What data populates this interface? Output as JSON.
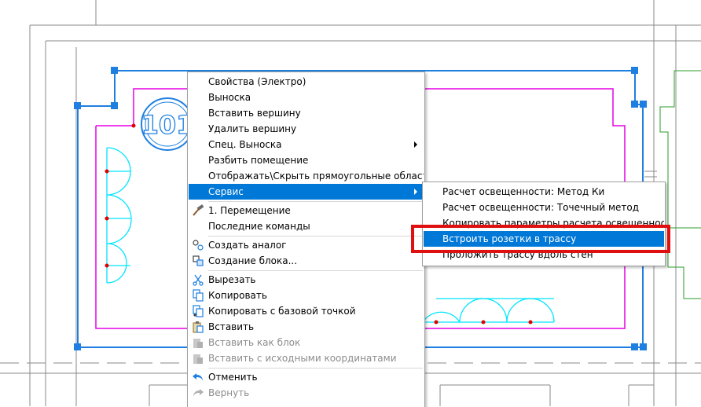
{
  "room_number": "101",
  "context_menu": {
    "items": [
      {
        "label": "Свойства (Электро)"
      },
      {
        "label": "Выноска"
      },
      {
        "label": "Вставить вершину"
      },
      {
        "label": "Удалить вершину"
      },
      {
        "label": "Спец. Выноска",
        "submenu": true
      },
      {
        "label": "Разбить помещение"
      },
      {
        "label": "Отображать\\Скрыть прямоугольные области"
      },
      {
        "label": "Сервис",
        "submenu": true,
        "highlighted": true
      },
      {
        "label": "1. Перемещение",
        "icon": "hammer-icon"
      },
      {
        "label": "Последние команды",
        "submenu": true
      },
      {
        "label": "Создать аналог",
        "icon": "create-analog-icon"
      },
      {
        "label": "Создание блока...",
        "icon": "create-block-icon"
      },
      {
        "label": "Вырезать",
        "icon": "scissors-icon"
      },
      {
        "label": "Копировать",
        "icon": "copy-icon"
      },
      {
        "label": "Копировать с базовой точкой",
        "icon": "copy-base-point-icon"
      },
      {
        "label": "Вставить",
        "icon": "paste-icon"
      },
      {
        "label": "Вставить как блок",
        "icon": "paste-block-icon",
        "disabled": true
      },
      {
        "label": "Вставить с исходными координатами",
        "icon": "paste-coords-icon",
        "disabled": true
      },
      {
        "label": "Отменить",
        "icon": "undo-icon"
      },
      {
        "label": "Вернуть",
        "icon": "redo-icon",
        "disabled": true
      }
    ]
  },
  "submenu": {
    "items": [
      {
        "label": "Расчет освещенности: Метод Ки"
      },
      {
        "label": "Расчет освещенности: Точечный метод"
      },
      {
        "label": "Копировать параметры расчета освещенности"
      },
      {
        "label": "Встроить розетки в трассу",
        "highlighted": true
      },
      {
        "label": "Проложить трассу вдоль стен"
      }
    ]
  },
  "colors": {
    "menu_highlight": "#0078d7",
    "annotation_box": "#e01010",
    "grip_blue": "#1e7fe0",
    "room_magenta": "#e600e6",
    "fixture_cyan": "#00e5ff",
    "wall_gray": "#7a7a7a"
  }
}
